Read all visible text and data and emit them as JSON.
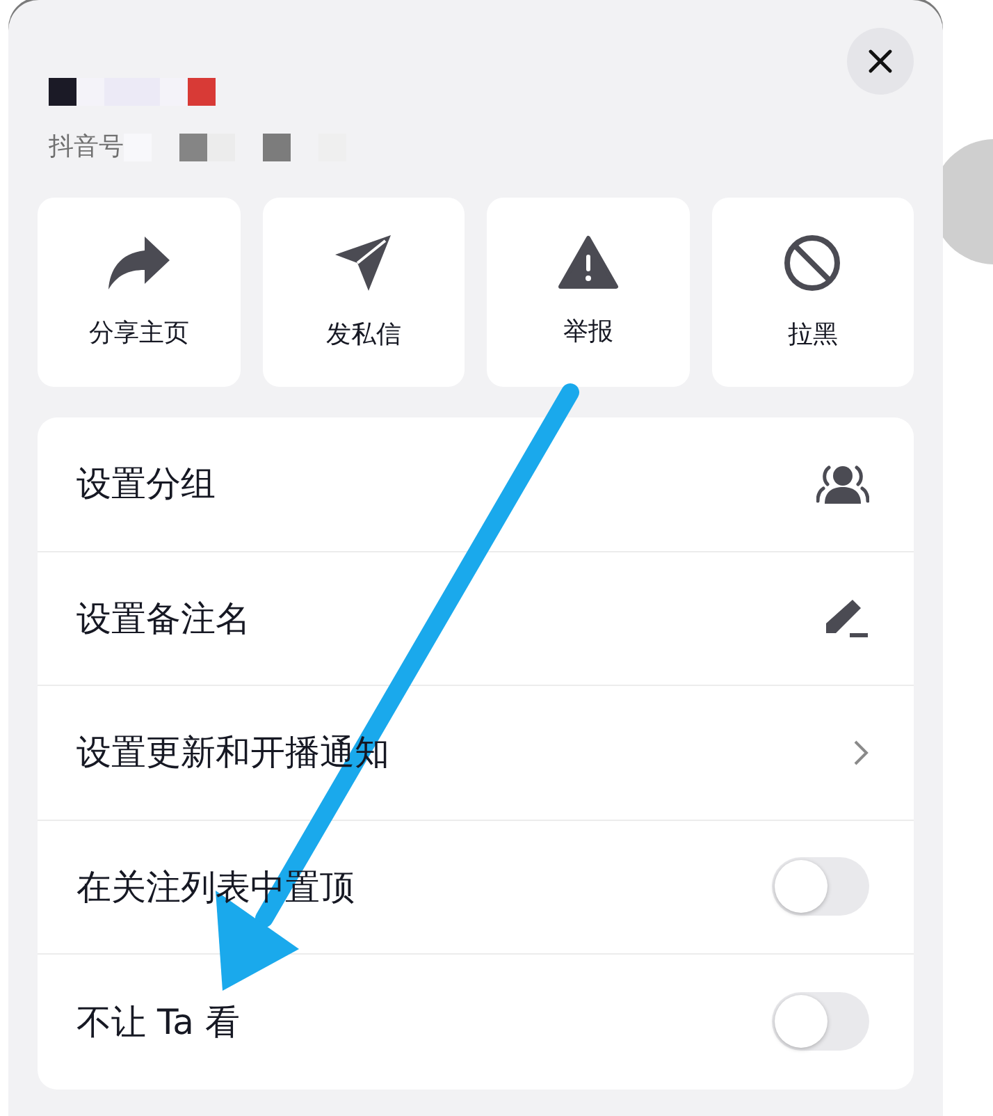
{
  "account_label": "抖音号",
  "actions": [
    {
      "label": "分享主页",
      "kind": "share"
    },
    {
      "label": "发私信",
      "kind": "send"
    },
    {
      "label": "举报",
      "kind": "report"
    },
    {
      "label": "拉黑",
      "kind": "block"
    }
  ],
  "settings": [
    {
      "label": "设置分组",
      "kind": "group"
    },
    {
      "label": "设置备注名",
      "kind": "edit"
    },
    {
      "label": "设置更新和开播通知",
      "kind": "link"
    },
    {
      "label": "在关注列表中置顶",
      "kind": "toggle",
      "on": false
    },
    {
      "label": "不让 Ta 看",
      "kind": "toggle",
      "on": false
    }
  ]
}
